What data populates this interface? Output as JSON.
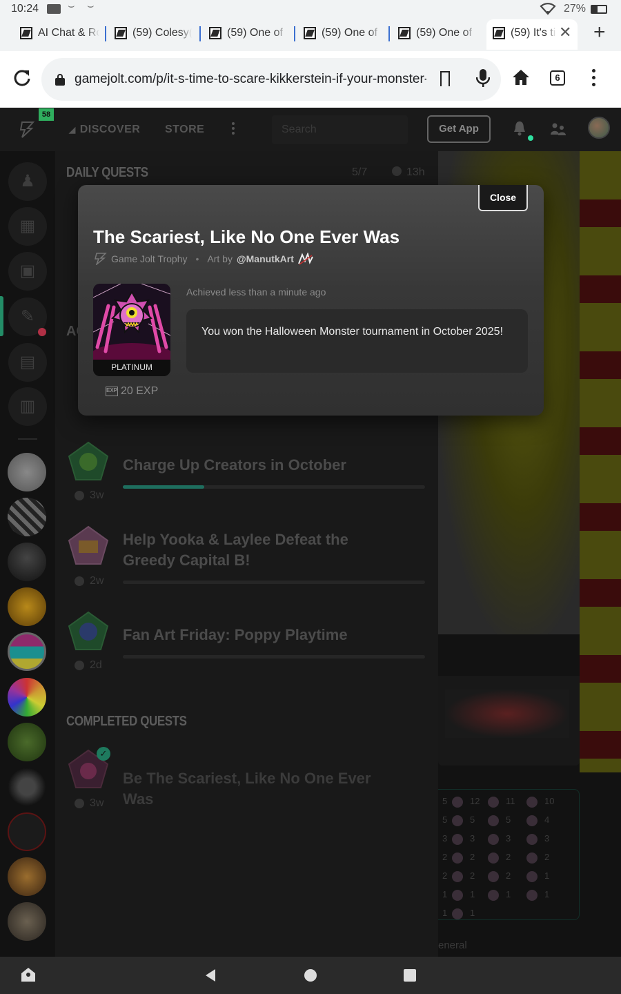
{
  "status_bar": {
    "time": "10:24",
    "battery": "27%"
  },
  "tabs": [
    {
      "label": "AI Chat & Ro"
    },
    {
      "label": "(59) Colesy("
    },
    {
      "label": "(59) One of t"
    },
    {
      "label": "(59) One of t"
    },
    {
      "label": "(59) One of t"
    },
    {
      "label": "(59) It's ti"
    }
  ],
  "browser": {
    "url": "gamejolt.com/p/it-s-time-to-scare-kikkerstein-if-your-monster-s",
    "tab_count": "6"
  },
  "header": {
    "notification_count": "58",
    "nav": [
      "DISCOVER",
      "STORE"
    ],
    "search_placeholder": "Search",
    "get_app": "Get App"
  },
  "daily_quests": {
    "title": "DAILY QUESTS",
    "progress": "5/7",
    "time_left": "13h"
  },
  "partial_section_label": "AC",
  "quests": [
    {
      "title": "Charge Up Creators in October",
      "time": "3w",
      "progress": 0.27
    },
    {
      "title": "Help Yooka & Laylee Defeat the Greedy Capital B!",
      "time": "2w",
      "progress": 0
    },
    {
      "title": "Fan Art Friday: Poppy Playtime",
      "time": "2d",
      "progress": 0
    }
  ],
  "completed_quests": {
    "title": "COMPLETED QUESTS",
    "items": [
      {
        "title": "Be The Scariest, Like No One Ever Was",
        "time": "3w"
      }
    ]
  },
  "modal": {
    "close": "Close",
    "title": "The Scariest, Like No One Ever Was",
    "source": "Game Jolt Trophy",
    "art_by_prefix": "Art by",
    "artist": "@ManutkArt",
    "achieved": "Achieved less than a minute ago",
    "description": "You won the Halloween Monster tournament in October 2025!",
    "tier": "PLATINUM",
    "exp": "20 EXP"
  },
  "right_pane": {
    "counts": [
      [
        "12",
        "11",
        "10"
      ],
      [
        "5",
        "5",
        "4"
      ],
      [
        "3",
        "3",
        "3"
      ],
      [
        "2",
        "2",
        "2"
      ],
      [
        "2",
        "2",
        "1"
      ],
      [
        "1",
        "1",
        "1"
      ],
      [
        "1"
      ]
    ],
    "left_counts": [
      "5",
      "5",
      "3",
      "2",
      "2",
      "1",
      "1"
    ],
    "footer_text": "eneral"
  },
  "colors": {
    "accent_green": "#2fe0a0",
    "quest_bar_fill": "#1e6e5e",
    "notification_badge": "#2fae5e"
  }
}
